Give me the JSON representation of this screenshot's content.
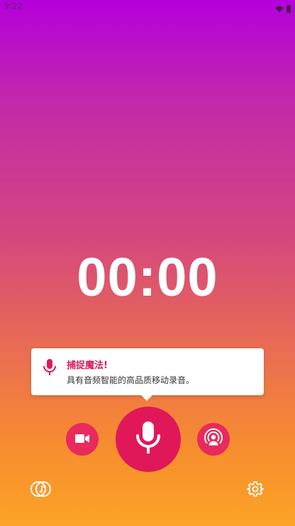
{
  "status_bar": {
    "time": "9:22",
    "icons": [
      "wifi-icon",
      "battery-icon"
    ]
  },
  "timer": {
    "value": "00:00"
  },
  "tooltip": {
    "icon": "microphone-icon",
    "title": "捕捉魔法!",
    "body": "具有音频智能的高品质移动录音。"
  },
  "controls": {
    "left_icon": "video-camera-icon",
    "center_icon": "microphone-icon",
    "right_icon": "live-broadcast-icon"
  },
  "bottom_bar": {
    "left_icon": "music-library-icon",
    "right_icon": "settings-gear-icon"
  },
  "colors": {
    "accent": "#e0185a",
    "gradient_top": "#b400dc",
    "gradient_bottom": "#fca326"
  }
}
